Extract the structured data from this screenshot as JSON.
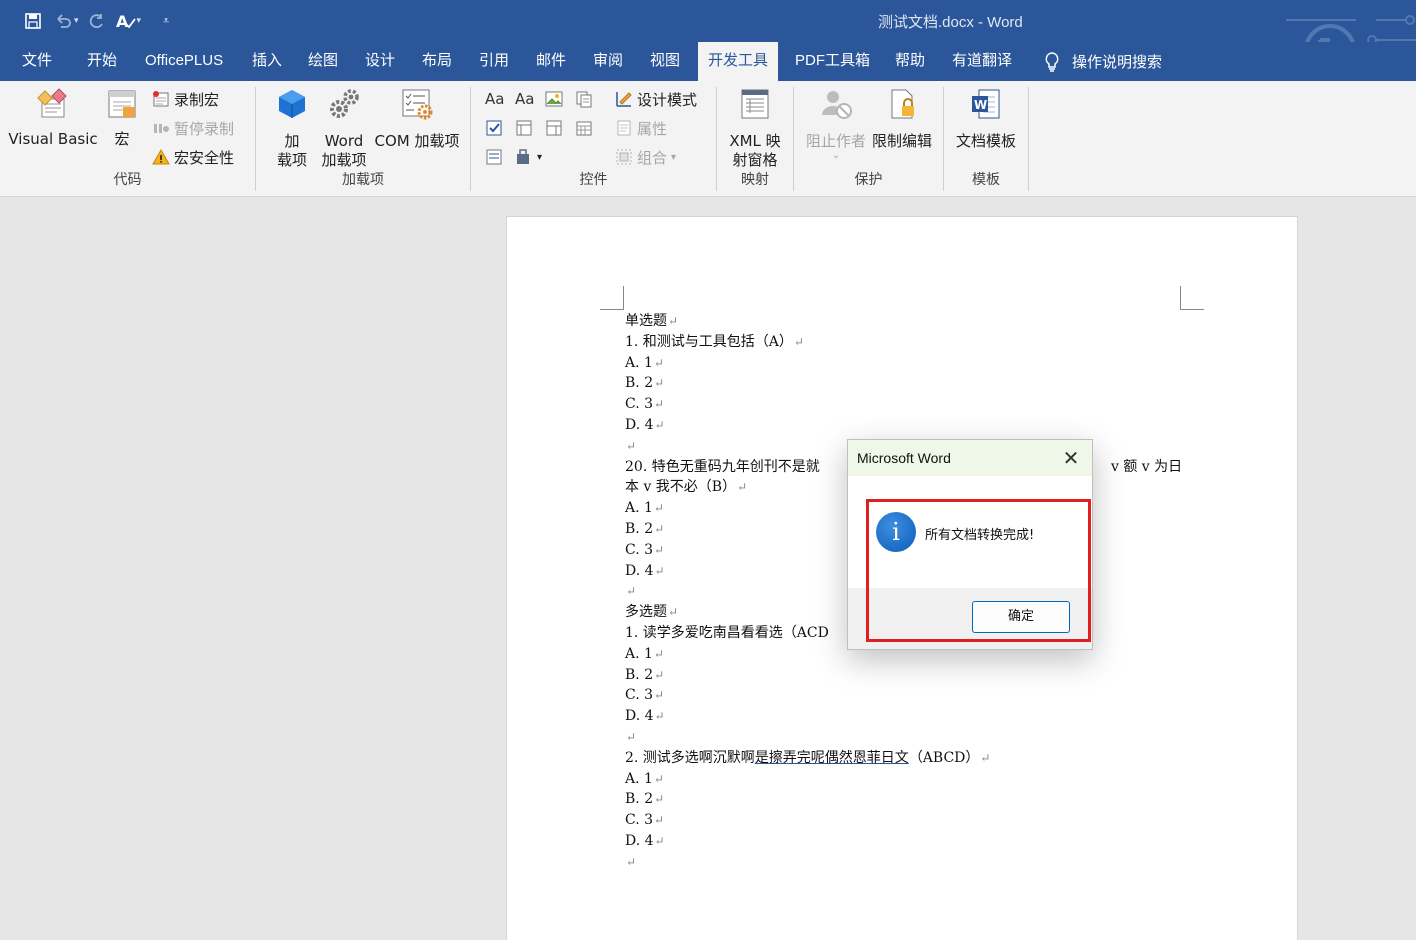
{
  "titlebar": {
    "doc_title": "测试文档.docx  -  Word"
  },
  "tabs": [
    "文件",
    "开始",
    "OfficePLUS",
    "插入",
    "绘图",
    "设计",
    "布局",
    "引用",
    "邮件",
    "审阅",
    "视图",
    "开发工具",
    "PDF工具箱",
    "帮助",
    "有道翻译"
  ],
  "tell_me": "操作说明搜索",
  "ribbon": {
    "code": {
      "label": "代码",
      "visual_basic": "Visual Basic",
      "macros": "宏",
      "record_macro": "录制宏",
      "pause_recording": "暂停录制",
      "macro_security": "宏安全性"
    },
    "addins": {
      "label": "加载项",
      "addins_line1": "加",
      "addins_line2": "载项",
      "word_addins_line1": "Word",
      "word_addins_line2": "加载项",
      "com_addins": "COM 加载项"
    },
    "controls": {
      "label": "控件",
      "design_mode": "设计模式",
      "properties": "属性",
      "group": "组合"
    },
    "mapping": {
      "label": "映射",
      "xml_line1": "XML 映",
      "xml_line2": "射窗格"
    },
    "protect": {
      "label": "保护",
      "block_authors": "阻止作者",
      "restrict_editing": "限制编辑"
    },
    "templates": {
      "label": "模板",
      "document_template": "文档模板"
    }
  },
  "document": {
    "lines": [
      "单选题",
      "1. 和测试与工具包括（A）",
      "A. 1",
      "B. 2",
      "C. 3",
      "D. 4",
      "",
      "20. 特色无重码九年创刊不是就",
      "本 v 我不必（B）",
      "A. 1",
      "B. 2",
      "C. 3",
      "D. 4",
      "",
      "多选题",
      "1. 读学多爱吃南昌看看选（ACD",
      "A. 1",
      "B. 2",
      "C. 3",
      "D. 4",
      "",
      "2. 测试多选啊沉默啊",
      "A. 1",
      "B. 2",
      "C. 3",
      "D. 4",
      ""
    ],
    "line20_tail": "v 额 v 为日",
    "line_q2_underlined": "是擦弄完呢偶然恩菲日文",
    "line_q2_tail": "（ABCD）"
  },
  "dialog": {
    "title": "Microsoft Word",
    "message": "所有文档转换完成!",
    "ok_label": "确定"
  }
}
